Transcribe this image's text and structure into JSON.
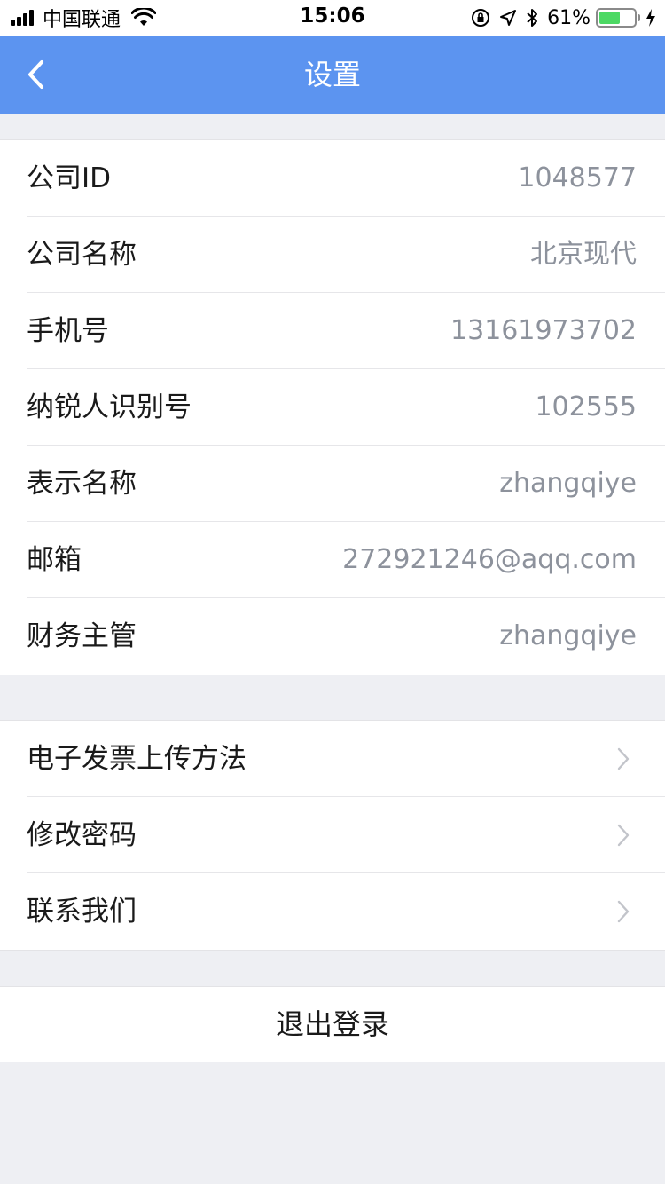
{
  "status_bar": {
    "carrier": "中国联通",
    "time": "15:06",
    "battery_percent": "61%",
    "battery_level": 0.61,
    "icons": [
      "signal-icon",
      "wifi-icon",
      "orientation-lock-icon",
      "location-icon",
      "bluetooth-icon",
      "battery-icon",
      "charging-icon"
    ]
  },
  "nav": {
    "title": "设置",
    "back_icon": "chevron-left-icon"
  },
  "info": {
    "rows": [
      {
        "label": "公司ID",
        "value": "1048577"
      },
      {
        "label": "公司名称",
        "value": "北京现代"
      },
      {
        "label": "手机号",
        "value": "13161973702"
      },
      {
        "label": "纳锐人识别号",
        "value": "102555"
      },
      {
        "label": "表示名称",
        "value": "zhangqiye"
      },
      {
        "label": "邮箱",
        "value": "272921246@aqq.com"
      },
      {
        "label": "财务主管",
        "value": "zhangqiye"
      }
    ]
  },
  "actions": {
    "rows": [
      {
        "label": "电子发票上传方法"
      },
      {
        "label": "修改密码"
      },
      {
        "label": "联系我们"
      }
    ]
  },
  "logout": {
    "label": "退出登录"
  },
  "colors": {
    "nav_bg": "#5c94f0",
    "page_bg": "#eeeff3",
    "value_text": "#8d929c",
    "battery_fill": "#4cd964"
  }
}
